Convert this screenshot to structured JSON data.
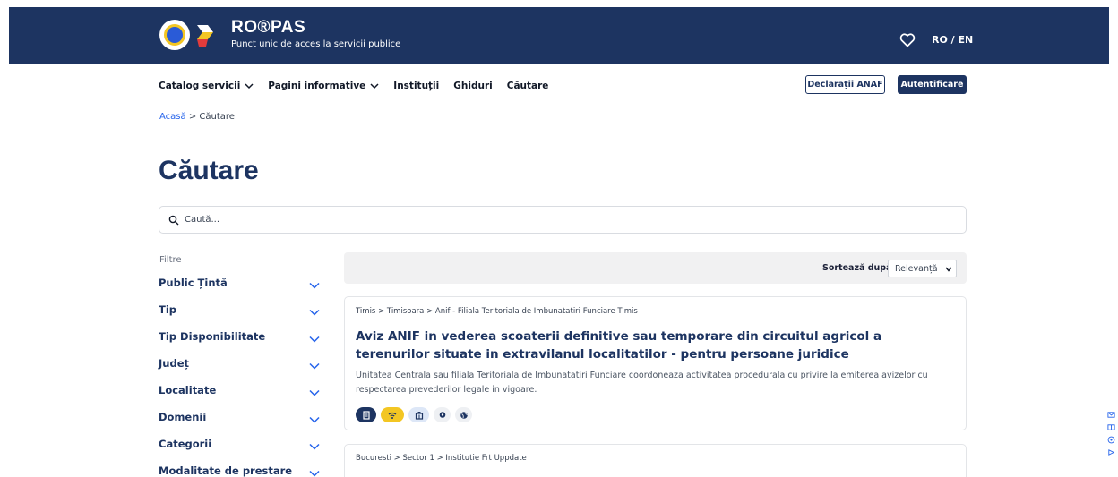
{
  "header": {
    "brand_name": "RO®PAS",
    "brand_tagline": "Punct unic de acces la servicii publice",
    "language": "RO / EN",
    "colors": {
      "primary": "#1d3461",
      "accent_yellow": "#f3c623",
      "accent_red": "#e23b3b"
    }
  },
  "nav": {
    "items": [
      {
        "label": "Catalog servicii",
        "has_dropdown": true
      },
      {
        "label": "Pagini informative",
        "has_dropdown": true
      },
      {
        "label": "Instituții",
        "has_dropdown": false
      },
      {
        "label": "Ghiduri",
        "has_dropdown": false
      },
      {
        "label": "Căutare",
        "has_dropdown": false
      }
    ],
    "declaratii_label": "Declarații ANAF",
    "login_label": "Autentificare"
  },
  "breadcrumb": {
    "home": "Acasă",
    "separator": ">",
    "current": "Căutare"
  },
  "page_title": "Căutare",
  "search": {
    "placeholder": "Caută...",
    "value": ""
  },
  "filters": {
    "label": "Filtre",
    "items": [
      "Public Țintă",
      "Tip",
      "Tip Disponibilitate",
      "Județ",
      "Localitate",
      "Domenii",
      "Categorii",
      "Modalitate de prestare"
    ]
  },
  "sort": {
    "label": "Sortează după:",
    "selected": "Relevanță"
  },
  "results": [
    {
      "breadcrumb": "Timis > Timisoara > Anif - Filiala Teritoriala de Imbunatatiri Funciare Timis",
      "title": "Aviz ANIF in vederea scoaterii definitive sau temporare din circuitul agricol a terenurilor situate in extravilanul localitatilor - pentru persoane juridice",
      "description": "Unitatea Centrala sau filiala Teritoriala de Imbunatatiri Funciare coordoneaza activitatea procedurala cu privire la emiterea avizelor cu respectarea prevederilor legale in vigoare.",
      "tags": [
        {
          "icon": "document-icon",
          "bg": "#1d3461",
          "fg": "#ffffff"
        },
        {
          "icon": "wifi-icon",
          "bg": "#f3c623",
          "fg": "#1d3461"
        },
        {
          "icon": "building-icon",
          "bg": "#dde7f7",
          "fg": "#1d3461"
        },
        {
          "icon": "location-pin-icon",
          "bg": "#eef0f3",
          "fg": "#1d3461"
        },
        {
          "icon": "globe-icon",
          "bg": "#eef0f3",
          "fg": "#1d3461"
        }
      ]
    },
    {
      "breadcrumb": "Bucuresti > Sector 1 > Institutie Frt Uppdate"
    }
  ],
  "side_widget": {
    "icons": [
      "mail-icon",
      "book-icon",
      "help-icon",
      "play-icon"
    ]
  }
}
